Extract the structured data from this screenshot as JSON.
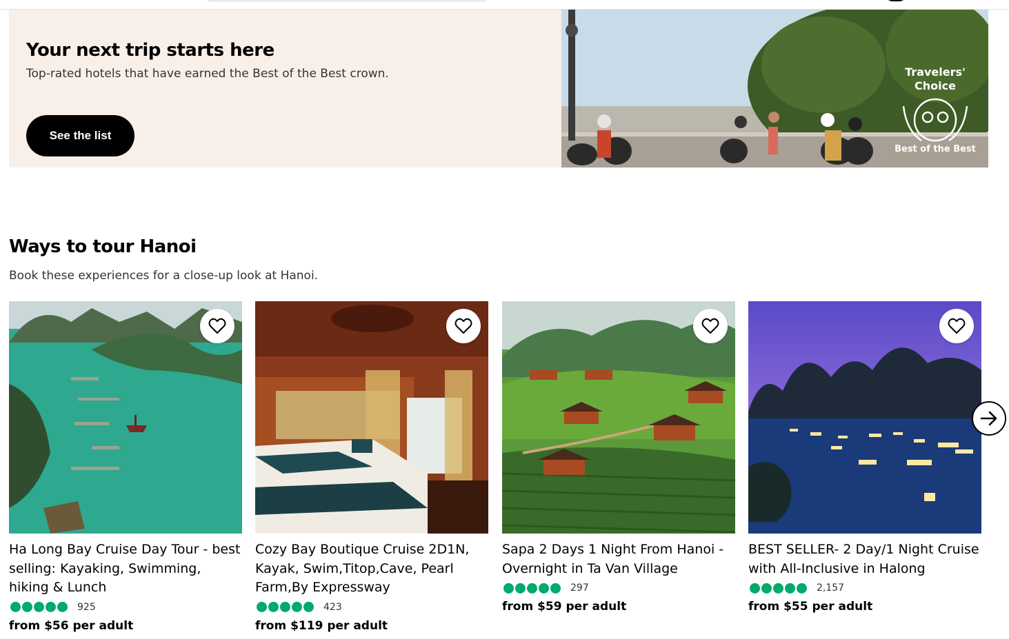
{
  "promo": {
    "title": "Your next trip starts here",
    "subtitle": "Top-rated hotels that have earned the Best of the Best crown.",
    "button_label": "See the list",
    "badge": {
      "line1": "Travelers'",
      "line2": "Choice",
      "line3": "Best of the Best"
    }
  },
  "section": {
    "title": "Ways to tour Hanoi",
    "subtitle": "Book these experiences for a close-up look at Hanoi."
  },
  "cards": [
    {
      "title": "Ha Long Bay Cruise Day Tour - best selling: Kayaking, Swimming, hiking & Lunch",
      "reviews": "925",
      "price": "from $56 per adult",
      "rating": 5
    },
    {
      "title": "Cozy Bay Boutique Cruise 2D1N, Kayak, Swim,Titop,Cave, Pearl Farm,By Expressway",
      "reviews": "423",
      "price": "from $119 per adult",
      "rating": 5
    },
    {
      "title": "Sapa 2 Days 1 Night From Hanoi - Overnight in Ta Van Village",
      "reviews": "297",
      "price": "from $59 per adult",
      "rating": 5
    },
    {
      "title": "BEST SELLER- 2 Day/1 Night Cruise with All-Inclusive in Halong",
      "reviews": "2,157",
      "price": "from $55 per adult",
      "rating": 5
    }
  ],
  "colors": {
    "rating_bubble": "#00aa6c",
    "promo_bg": "#f9efe9",
    "button_bg": "#000000"
  },
  "icons": {
    "favorite": "heart-outline-icon",
    "next": "arrow-right-icon"
  }
}
